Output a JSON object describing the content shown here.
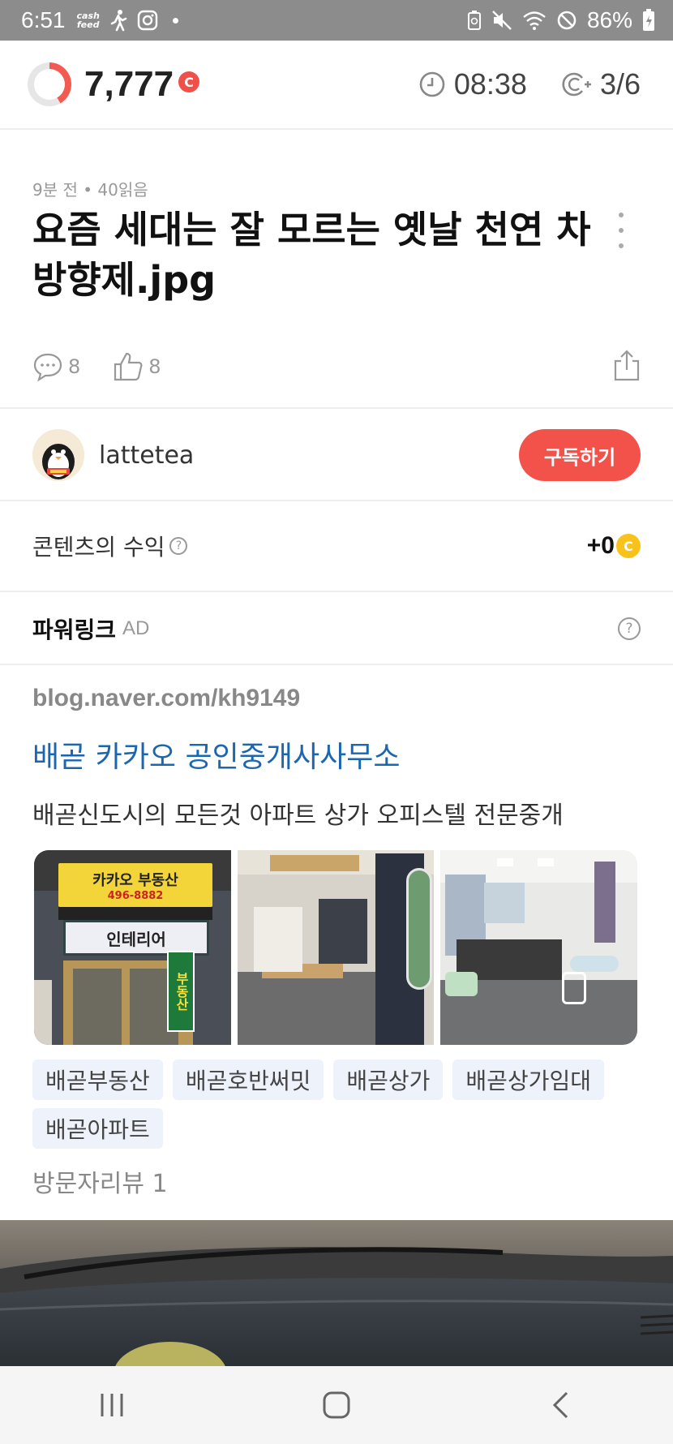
{
  "status_bar": {
    "time": "6:51",
    "cashfeed_line1": "cash",
    "cashfeed_line2": "feed",
    "battery": "86%"
  },
  "header": {
    "points": "7,777",
    "coin_symbol": "C",
    "timer": "08:38",
    "progress": "3/6"
  },
  "article": {
    "meta": "9분 전 • 40읽음",
    "title": "요즘 세대는 잘 모르는 옛날 천연 차 방향제.jpg",
    "comments": "8",
    "likes": "8"
  },
  "author": {
    "name": "lattetea",
    "subscribe_label": "구독하기"
  },
  "revenue": {
    "label": "콘텐츠의 수익",
    "value": "+0",
    "coin_symbol": "C"
  },
  "powerlink": {
    "title": "파워링크",
    "ad_label": "AD",
    "url": "blog.naver.com/kh9149",
    "ad_title": "배곧 카카오 공인중개사사무소",
    "description": "배곧신도시의 모든것 아파트 상가 오피스텔 전문중개",
    "images": [
      {
        "sign_top": "카카오 부동산",
        "sign_phone": "496-8882",
        "sign_mid": "인테리어",
        "sign_side": "부동산"
      },
      {
        "alt": "office-interior"
      },
      {
        "alt": "office-desks"
      }
    ],
    "tags": [
      "배곧부동산",
      "배곧호반써밋",
      "배곧상가",
      "배곧상가임대",
      "배곧아파트"
    ],
    "visit_review": "방문자리뷰 1"
  },
  "colors": {
    "accent": "#f3524b",
    "link": "#1a66b0",
    "coin_yellow": "#f9c21a"
  }
}
